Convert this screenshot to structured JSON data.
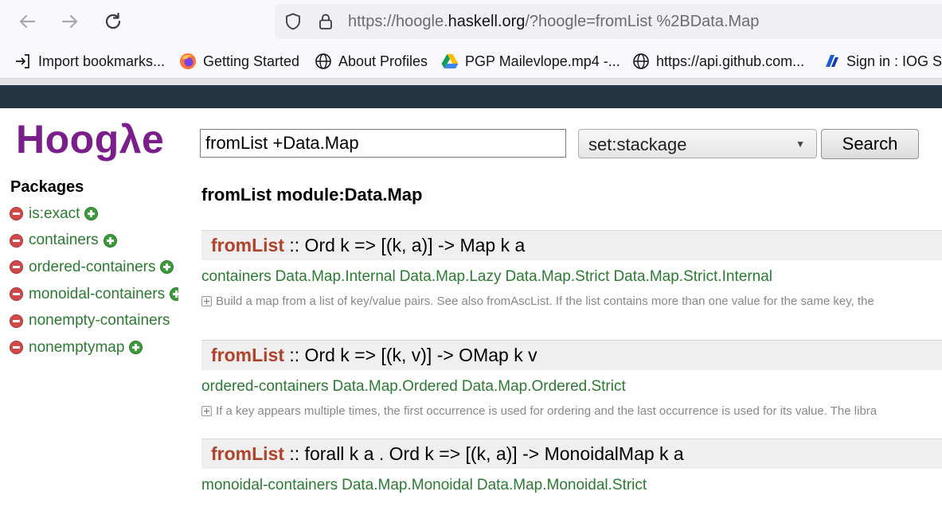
{
  "browser": {
    "url_prefix": "https://hoogle.",
    "url_domain": "haskell.org",
    "url_suffix": "/?hoogle=fromList %2BData.Map",
    "bookmarks": [
      {
        "label": "Import bookmarks...",
        "icon": "import-icon"
      },
      {
        "label": "Getting Started",
        "icon": "firefox-icon"
      },
      {
        "label": "About Profiles",
        "icon": "globe-icon"
      },
      {
        "label": "PGP Mailevlope.mp4 -...",
        "icon": "google-drive-icon"
      },
      {
        "label": "https://api.github.com...",
        "icon": "globe-icon"
      },
      {
        "label": "Sign in : IOG Sin",
        "icon": "iog-icon"
      }
    ]
  },
  "search": {
    "logo": "Hoogλe",
    "query": "fromList +Data.Map",
    "scope": "set:stackage",
    "button": "Search"
  },
  "sidebar": {
    "heading": "Packages",
    "packages": [
      {
        "name": "is:exact",
        "plus": true
      },
      {
        "name": "containers",
        "plus": true
      },
      {
        "name": "ordered-containers",
        "plus": true
      },
      {
        "name": "monoidal-containers",
        "plus": true
      },
      {
        "name": "nonempty-containers",
        "plus": false
      },
      {
        "name": "nonemptymap",
        "plus": true
      }
    ]
  },
  "main": {
    "heading": "fromList module:Data.Map",
    "results": [
      {
        "name": "fromList",
        "signature": ":: Ord k => [(k, a)] -> Map k a",
        "package": "containers",
        "modules": [
          "Data.Map.Internal",
          "Data.Map.Lazy",
          "Data.Map.Strict",
          "Data.Map.Strict.Internal"
        ],
        "doc": "Build a map from a list of key/value pairs. See also fromAscList. If the list contains more than one value for the same key, the"
      },
      {
        "name": "fromList",
        "signature": ":: Ord k => [(k, v)] -> OMap k v",
        "package": "ordered-containers",
        "modules": [
          "Data.Map.Ordered",
          "Data.Map.Ordered.Strict"
        ],
        "doc": "If a key appears multiple times, the first occurrence is used for ordering and the last occurrence is used for its value. The libra"
      },
      {
        "name": "fromList",
        "signature": ":: forall k a . Ord k => [(k, a)] -> MonoidalMap k a",
        "package": "monoidal-containers",
        "modules": [
          "Data.Map.Monoidal",
          "Data.Map.Monoidal.Strict"
        ]
      }
    ]
  },
  "colors": {
    "logo": "#7b1e8c",
    "function_name": "#b0422a",
    "link_green": "#2b7a32",
    "header_bar": "#243443"
  }
}
